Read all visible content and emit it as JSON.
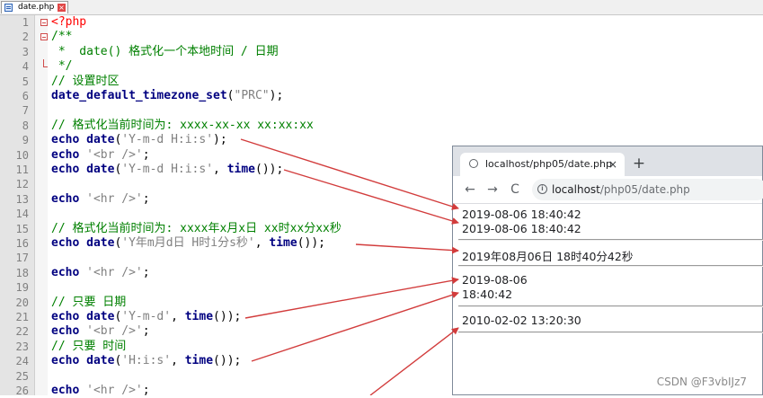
{
  "editor": {
    "tab_name": "date.php",
    "lines": [
      {
        "n": "1",
        "parts": [
          {
            "t": "<?php",
            "c": "php"
          }
        ]
      },
      {
        "n": "2",
        "parts": [
          {
            "t": "/**",
            "c": "c"
          }
        ]
      },
      {
        "n": "3",
        "parts": [
          {
            "t": " *  date() 格式化一个本地时间 / 日期",
            "c": "c"
          }
        ]
      },
      {
        "n": "4",
        "parts": [
          {
            "t": " */",
            "c": "c"
          }
        ]
      },
      {
        "n": "5",
        "parts": [
          {
            "t": "// 设置时区",
            "c": "c"
          }
        ]
      },
      {
        "n": "6",
        "parts": [
          {
            "t": "date_default_timezone_set",
            "c": "k"
          },
          {
            "t": "(",
            "c": "p"
          },
          {
            "t": "\"PRC\"",
            "c": "s"
          },
          {
            "t": ");",
            "c": "p"
          }
        ]
      },
      {
        "n": "7",
        "parts": []
      },
      {
        "n": "8",
        "parts": [
          {
            "t": "// 格式化当前时间为: xxxx-xx-xx xx:xx:xx",
            "c": "c"
          }
        ]
      },
      {
        "n": "9",
        "parts": [
          {
            "t": "echo ",
            "c": "k"
          },
          {
            "t": "date",
            "c": "k"
          },
          {
            "t": "(",
            "c": "p"
          },
          {
            "t": "'Y-m-d H:i:s'",
            "c": "s"
          },
          {
            "t": ");",
            "c": "p"
          }
        ]
      },
      {
        "n": "10",
        "parts": [
          {
            "t": "echo ",
            "c": "k"
          },
          {
            "t": "'<br />'",
            "c": "s"
          },
          {
            "t": ";",
            "c": "p"
          }
        ]
      },
      {
        "n": "11",
        "parts": [
          {
            "t": "echo ",
            "c": "k"
          },
          {
            "t": "date",
            "c": "k"
          },
          {
            "t": "(",
            "c": "p"
          },
          {
            "t": "'Y-m-d H:i:s'",
            "c": "s"
          },
          {
            "t": ", ",
            "c": "p"
          },
          {
            "t": "time",
            "c": "k"
          },
          {
            "t": "());",
            "c": "p"
          }
        ]
      },
      {
        "n": "12",
        "parts": []
      },
      {
        "n": "13",
        "parts": [
          {
            "t": "echo ",
            "c": "k"
          },
          {
            "t": "'<hr />'",
            "c": "s"
          },
          {
            "t": ";",
            "c": "p"
          }
        ]
      },
      {
        "n": "14",
        "parts": []
      },
      {
        "n": "15",
        "parts": [
          {
            "t": "// 格式化当前时间为: xxxx年x月x日 xx时xx分xx秒",
            "c": "c"
          }
        ]
      },
      {
        "n": "16",
        "parts": [
          {
            "t": "echo ",
            "c": "k"
          },
          {
            "t": "date",
            "c": "k"
          },
          {
            "t": "(",
            "c": "p"
          },
          {
            "t": "'Y年m月d日 H时i分s秒'",
            "c": "s"
          },
          {
            "t": ", ",
            "c": "p"
          },
          {
            "t": "time",
            "c": "k"
          },
          {
            "t": "());",
            "c": "p"
          }
        ]
      },
      {
        "n": "17",
        "parts": []
      },
      {
        "n": "18",
        "parts": [
          {
            "t": "echo ",
            "c": "k"
          },
          {
            "t": "'<hr />'",
            "c": "s"
          },
          {
            "t": ";",
            "c": "p"
          }
        ]
      },
      {
        "n": "19",
        "parts": []
      },
      {
        "n": "20",
        "parts": [
          {
            "t": "// 只要 日期",
            "c": "c"
          }
        ]
      },
      {
        "n": "21",
        "parts": [
          {
            "t": "echo ",
            "c": "k"
          },
          {
            "t": "date",
            "c": "k"
          },
          {
            "t": "(",
            "c": "p"
          },
          {
            "t": "'Y-m-d'",
            "c": "s"
          },
          {
            "t": ", ",
            "c": "p"
          },
          {
            "t": "time",
            "c": "k"
          },
          {
            "t": "());",
            "c": "p"
          }
        ]
      },
      {
        "n": "22",
        "parts": [
          {
            "t": "echo ",
            "c": "k"
          },
          {
            "t": "'<br />'",
            "c": "s"
          },
          {
            "t": ";",
            "c": "p"
          }
        ]
      },
      {
        "n": "23",
        "parts": [
          {
            "t": "// 只要 时间",
            "c": "c"
          }
        ]
      },
      {
        "n": "24",
        "parts": [
          {
            "t": "echo ",
            "c": "k"
          },
          {
            "t": "date",
            "c": "k"
          },
          {
            "t": "(",
            "c": "p"
          },
          {
            "t": "'H:i:s'",
            "c": "s"
          },
          {
            "t": ", ",
            "c": "p"
          },
          {
            "t": "time",
            "c": "k"
          },
          {
            "t": "());",
            "c": "p"
          }
        ]
      },
      {
        "n": "25",
        "parts": []
      },
      {
        "n": "26",
        "parts": [
          {
            "t": "echo ",
            "c": "k"
          },
          {
            "t": "'<hr />'",
            "c": "s"
          },
          {
            "t": ";",
            "c": "p"
          }
        ]
      }
    ]
  },
  "browser": {
    "tab_title": "localhost/php05/date.php",
    "tab_close": "×",
    "new_tab": "+",
    "back": "←",
    "forward": "→",
    "reload": "C",
    "url_host": "localhost",
    "url_path": "/php05/date.php",
    "output": {
      "line1": "2019-08-06 18:40:42",
      "line2": "2019-08-06 18:40:42",
      "line3": "2019年08月06日 18时40分42秒",
      "line4": "2019-08-06",
      "line5": "18:40:42",
      "line6": "2010-02-02 13:20:30"
    }
  },
  "watermark": "CSDN @F3vbIJz7",
  "colors": {
    "arrow": "#d23c3c",
    "keyword": "#000080",
    "comment": "#008000",
    "string": "#808080",
    "php_tag": "#ff0000"
  }
}
